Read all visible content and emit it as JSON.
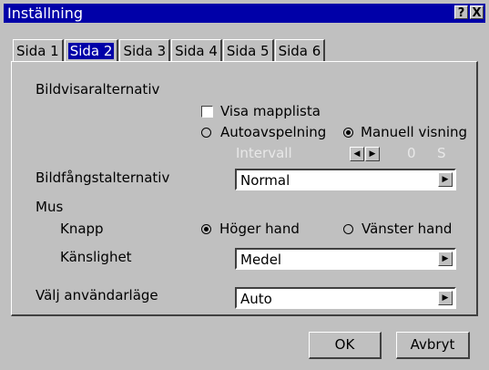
{
  "window": {
    "title": "Inställning",
    "help_label": "?",
    "close_label": "X"
  },
  "tabs": [
    {
      "label": "Sida 1"
    },
    {
      "label": "Sida 2"
    },
    {
      "label": "Sida 3"
    },
    {
      "label": "Sida 4"
    },
    {
      "label": "Sida 5"
    },
    {
      "label": "Sida 6"
    }
  ],
  "active_tab": "Sida 2",
  "viewer": {
    "heading": "Bildvisaralternativ",
    "show_folder_list": "Visa mapplista",
    "show_folder_list_checked": false,
    "auto_play": "Autoavspelning",
    "manual_view": "Manuell visning",
    "selected_mode": "Manuell visning",
    "interval_label": "Intervall",
    "interval_value": "0",
    "interval_unit": "S"
  },
  "capture": {
    "label": "Bildfångstalternativ",
    "value": "Normal"
  },
  "mouse": {
    "heading": "Mus",
    "button_label": "Knapp",
    "right_hand": "Höger hand",
    "left_hand": "Vänster hand",
    "selected_hand": "Höger hand",
    "sensitivity_label": "Känslighet",
    "sensitivity_value": "Medel"
  },
  "user_mode": {
    "label": "Välj användarläge",
    "value": "Auto"
  },
  "footer": {
    "ok_label": "OK",
    "cancel_label": "Avbryt"
  }
}
